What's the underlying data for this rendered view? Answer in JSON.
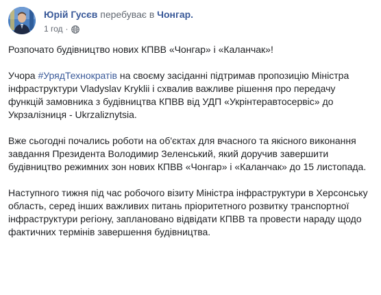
{
  "post": {
    "author": "Юрій Гусєв",
    "verb": "перебуває в",
    "location": "Чонгар.",
    "timestamp": "1 год",
    "separator": "·",
    "privacy_icon": "globe-icon",
    "paragraphs": [
      {
        "text": "Розпочато будівництво нових КПВВ «Чонгар» і «Каланчак»!"
      },
      {
        "before": "Учора ",
        "hashtag": "#УрядТехнократів",
        "after": " на своєму засіданні підтримав пропозицію Міністра інфраструктури Vladyslav Kryklii і схвалив важливе рішення про передачу функцій замовника з будівництва КПВВ від УДП «Укрінтеравтосервіс» до Укрзалізниця - Ukrzaliznytsia."
      },
      {
        "text": "Вже сьогодні почались роботи на об'єктах для вчасного та якісного виконання завдання Президента Володимир Зеленський, який доручив завершити будівництво режимних зон нових КПВВ «Чонгар» і «Каланчак» до 15 листопада."
      },
      {
        "text": "Наступного тижня під час робочого візиту Міністра інфраструктури в Херсонську область, серед інших важливих питань пріоритетного розвитку транспортної інфраструктури регіону, заплановано відвідати КПВВ та провести нараду щодо фактичних термінів завершення будівництва."
      }
    ]
  },
  "colors": {
    "link": "#385898",
    "text": "#1c1e21",
    "meta": "#616770"
  }
}
